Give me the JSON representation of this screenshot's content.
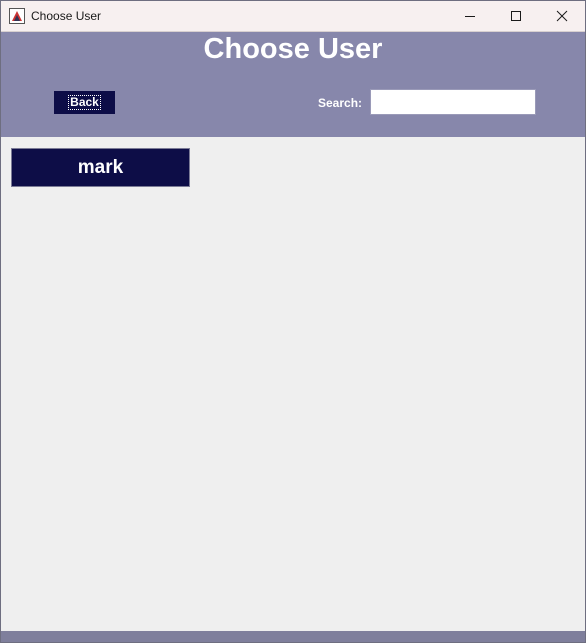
{
  "window": {
    "title": "Choose User",
    "controls": [
      "minimize-icon",
      "maximize-icon",
      "close-icon"
    ]
  },
  "header": {
    "title": "Choose User",
    "back_label": "Back",
    "search_label": "Search:",
    "search_value": ""
  },
  "users": [
    {
      "name": "mark"
    }
  ],
  "colors": {
    "header_bg": "#8787ab",
    "button_bg": "#0d0d47",
    "content_bg": "#efefef",
    "titlebar_bg": "#f7f0f0"
  }
}
